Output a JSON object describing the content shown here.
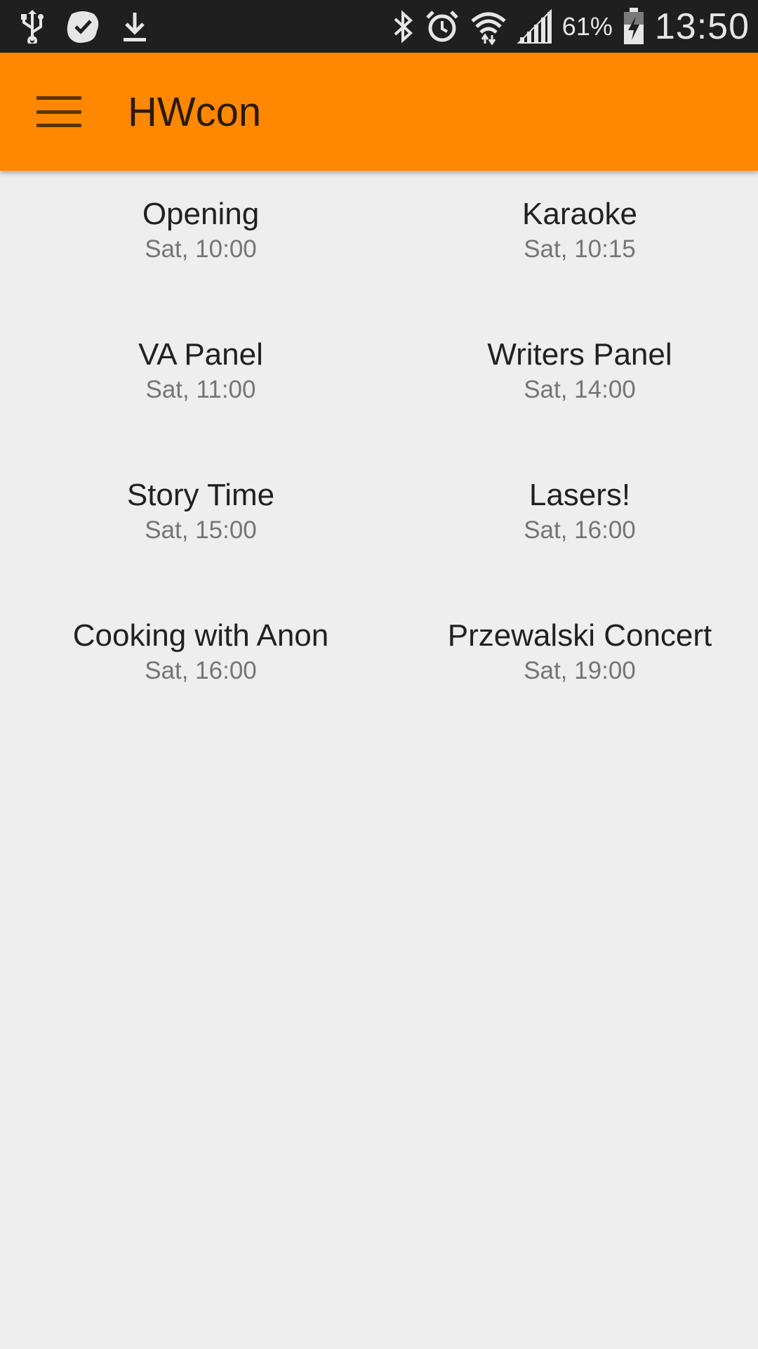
{
  "status_bar": {
    "icons_left": [
      "usb-icon",
      "checkmark-notification-icon",
      "download-icon"
    ],
    "icons_right": [
      "bluetooth-icon",
      "alarm-icon",
      "wifi-icon",
      "signal-icon",
      "battery-charging-icon"
    ],
    "battery_percent": "61%",
    "time": "13:50"
  },
  "app_bar": {
    "title": "HWcon",
    "color": "#ff8800",
    "menu_icon": "hamburger-menu-icon"
  },
  "events": [
    {
      "name": "Opening",
      "time": "Sat, 10:00"
    },
    {
      "name": "Karaoke",
      "time": "Sat, 10:15"
    },
    {
      "name": "VA Panel",
      "time": "Sat, 11:00"
    },
    {
      "name": "Writers Panel",
      "time": "Sat, 14:00"
    },
    {
      "name": "Story Time",
      "time": "Sat, 15:00"
    },
    {
      "name": "Lasers!",
      "time": "Sat, 16:00"
    },
    {
      "name": "Cooking with Anon",
      "time": "Sat, 16:00"
    },
    {
      "name": "Przewalski Concert",
      "time": "Sat, 19:00"
    }
  ]
}
